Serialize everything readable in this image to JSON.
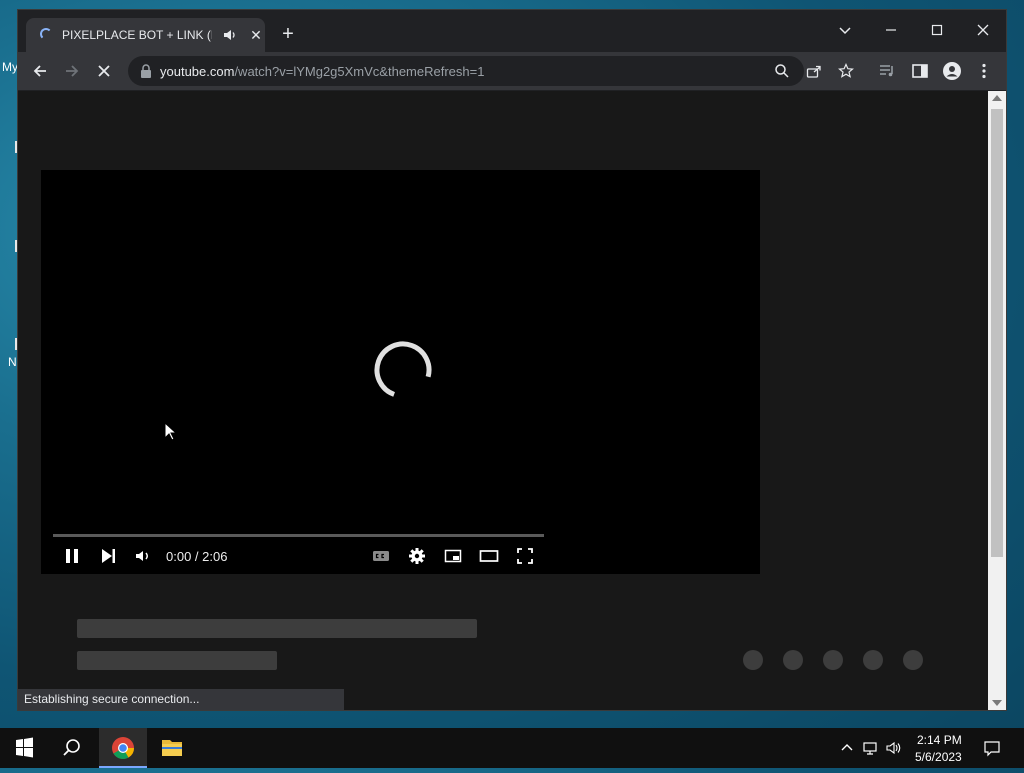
{
  "desktop": {
    "fragments": [
      "My",
      "N"
    ]
  },
  "browser": {
    "tab": {
      "title": "PIXELPLACE BOT + LINK (FRE",
      "close_glyph": "✕",
      "new_tab_glyph": "+"
    },
    "address_bar": {
      "host": "youtube.com",
      "path": "/watch?v=lYMg2g5XmVc&themeRefresh=1"
    },
    "status_text": "Establishing secure connection..."
  },
  "video_player": {
    "state": "loading",
    "timecode": "0:00 / 2:06",
    "progress_fraction": 0
  },
  "page_placeholders": {
    "skeleton_bars": 2,
    "skeleton_dots": 5
  },
  "taskbar": {
    "apps": [
      "start-icon",
      "search-icon",
      "chrome-icon",
      "file-explorer-icon"
    ],
    "active_app": "chrome-icon",
    "time": "2:14 PM",
    "date": "5/6/2023"
  },
  "colors": {
    "accent": "#8ab4f8",
    "browser_frame": "#202124",
    "toolbar": "#35363a",
    "page_bg": "#181818",
    "taskbar": "#101010"
  }
}
